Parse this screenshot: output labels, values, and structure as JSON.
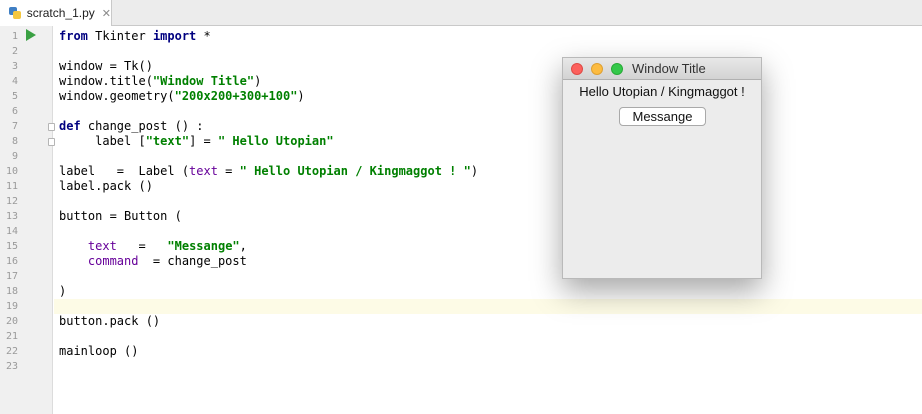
{
  "tab": {
    "name": "scratch_1.py",
    "close_symbol": "✕"
  },
  "editor": {
    "highlighted_line": 19,
    "lines": [
      {
        "n": "1",
        "tokens": [
          {
            "t": "from",
            "c": "kw"
          },
          {
            "t": " Tkinter ",
            "c": ""
          },
          {
            "t": "import",
            "c": "kw"
          },
          {
            "t": " *",
            "c": ""
          }
        ]
      },
      {
        "n": "2",
        "tokens": []
      },
      {
        "n": "3",
        "tokens": [
          {
            "t": "window = Tk()",
            "c": ""
          }
        ]
      },
      {
        "n": "4",
        "tokens": [
          {
            "t": "window.title(",
            "c": ""
          },
          {
            "t": "\"Window Title\"",
            "c": "str"
          },
          {
            "t": ")",
            "c": ""
          }
        ]
      },
      {
        "n": "5",
        "tokens": [
          {
            "t": "window.geometry(",
            "c": ""
          },
          {
            "t": "\"200x200+300+100\"",
            "c": "str"
          },
          {
            "t": ")",
            "c": ""
          }
        ]
      },
      {
        "n": "6",
        "tokens": []
      },
      {
        "n": "7",
        "tokens": [
          {
            "t": "def",
            "c": "kw"
          },
          {
            "t": " change_post () :",
            "c": ""
          }
        ]
      },
      {
        "n": "8",
        "tokens": [
          {
            "t": "     label [",
            "c": ""
          },
          {
            "t": "\"text\"",
            "c": "str"
          },
          {
            "t": "] = ",
            "c": ""
          },
          {
            "t": "\" Hello Utopian\"",
            "c": "str"
          }
        ]
      },
      {
        "n": "9",
        "tokens": []
      },
      {
        "n": "10",
        "tokens": [
          {
            "t": "label   =  Label (",
            "c": ""
          },
          {
            "t": "text",
            "c": "kwarg"
          },
          {
            "t": " = ",
            "c": ""
          },
          {
            "t": "\" Hello Utopian / Kingmaggot ! \"",
            "c": "str"
          },
          {
            "t": ")",
            "c": ""
          }
        ]
      },
      {
        "n": "11",
        "tokens": [
          {
            "t": "label.pack ()",
            "c": ""
          }
        ]
      },
      {
        "n": "12",
        "tokens": []
      },
      {
        "n": "13",
        "tokens": [
          {
            "t": "button = Button (",
            "c": ""
          }
        ]
      },
      {
        "n": "14",
        "tokens": []
      },
      {
        "n": "15",
        "tokens": [
          {
            "t": "    ",
            "c": ""
          },
          {
            "t": "text",
            "c": "kwarg"
          },
          {
            "t": "   =   ",
            "c": ""
          },
          {
            "t": "\"Messange\"",
            "c": "str"
          },
          {
            "t": ",",
            "c": ""
          }
        ]
      },
      {
        "n": "16",
        "tokens": [
          {
            "t": "    ",
            "c": ""
          },
          {
            "t": "command",
            "c": "kwarg"
          },
          {
            "t": "  = change_post",
            "c": ""
          }
        ]
      },
      {
        "n": "17",
        "tokens": []
      },
      {
        "n": "18",
        "tokens": [
          {
            "t": ")",
            "c": ""
          }
        ]
      },
      {
        "n": "19",
        "tokens": []
      },
      {
        "n": "20",
        "tokens": [
          {
            "t": "button.pack ()",
            "c": ""
          }
        ]
      },
      {
        "n": "21",
        "tokens": []
      },
      {
        "n": "22",
        "tokens": [
          {
            "t": "mainloop ()",
            "c": ""
          }
        ]
      },
      {
        "n": "23",
        "tokens": []
      }
    ]
  },
  "tk_window": {
    "title": "Window Title",
    "label_text": "Hello Utopian / Kingmaggot !",
    "button_text": "Messange"
  },
  "colors": {
    "keyword": "#000080",
    "string": "#008000",
    "kwarg": "#660099",
    "run_icon": "#3aa043",
    "caret_row": "#fdfbe6"
  },
  "icons": {
    "tab_file": "python-file-icon",
    "run": "run-triangle-icon",
    "fold": "fold-marker-icon"
  }
}
